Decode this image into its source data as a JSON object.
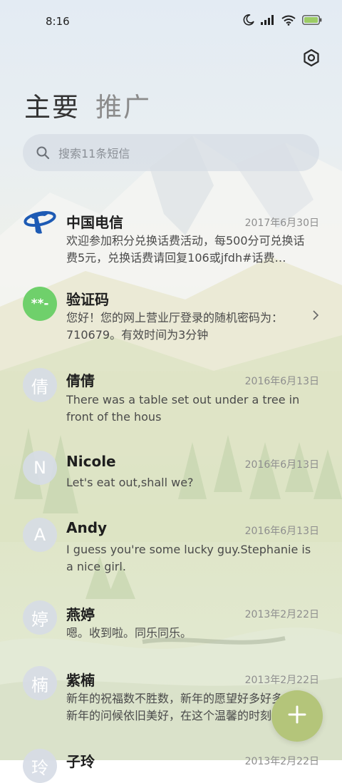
{
  "status_bar": {
    "time": "8:16",
    "icons": [
      "moon-icon",
      "signal-icon",
      "wifi-icon",
      "battery-icon"
    ],
    "battery_color": "#9ccc65"
  },
  "header": {
    "tabs": [
      {
        "label": "主要",
        "active": true
      },
      {
        "label": "推广",
        "active": false
      }
    ],
    "settings_icon": "gear-icon"
  },
  "search": {
    "placeholder": "搜索11条短信",
    "icon": "search-icon"
  },
  "conversations": [
    {
      "avatar": "china-telecom-logo",
      "name": "中国电信",
      "date": "2017年6月30日",
      "snippet": "欢迎参加积分兑换话费活动，每500分可兑换话费5元，兑换话费请回复106或jfdh#话费…"
    },
    {
      "avatar": "**-",
      "avatar_color": "#6fd06b",
      "name": "验证码",
      "date": "",
      "snippet": "您好！您的网上营业厅登录的随机密码为：710679。有效时间为3分钟",
      "chevron": true
    },
    {
      "avatar": "倩",
      "name": "倩倩",
      "date": "2016年6月13日",
      "snippet": "There was a table set out under a tree in front of the hous"
    },
    {
      "avatar": "N",
      "name": "Nicole",
      "date": "2016年6月13日",
      "snippet": "Let's eat out,shall we?"
    },
    {
      "avatar": "A",
      "name": "Andy",
      "date": "2016年6月13日",
      "snippet": "I guess you're some lucky guy.Stephanie is a nice girl."
    },
    {
      "avatar": "婷",
      "name": "燕婷",
      "date": "2013年2月22日",
      "snippet": "嗯。收到啦。同乐同乐。"
    },
    {
      "avatar": "楠",
      "name": "紫楠",
      "date": "2013年2月22日",
      "snippet": "新年的祝福数不胜数，新年的愿望好多好多，新年的问候依旧美好，在这个温馨的时刻"
    },
    {
      "avatar": "玲",
      "name": "子玲",
      "date": "2013年2月22日",
      "snippet": ""
    }
  ],
  "fab": {
    "icon": "plus-icon",
    "color": "#b4c57a"
  }
}
